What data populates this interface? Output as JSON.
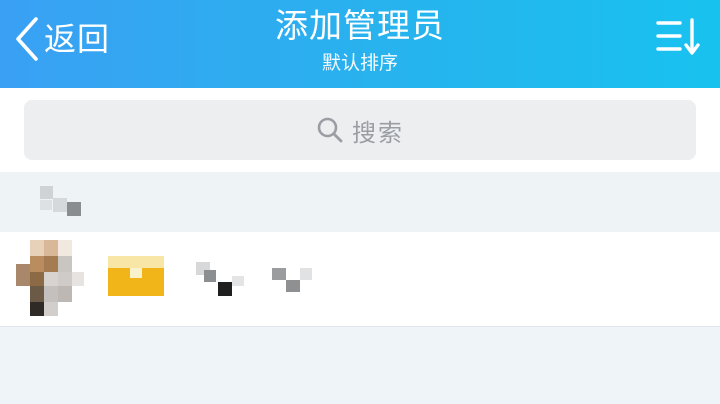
{
  "header": {
    "back_label": "返回",
    "title": "添加管理员",
    "subtitle": "默认排序",
    "back_icon": "chevron-left-icon",
    "sort_icon": "sort-icon"
  },
  "search": {
    "placeholder": "搜索",
    "icon": "search-icon"
  },
  "colors": {
    "header_gradient_start": "#3aa0f4",
    "header_gradient_end": "#18c2ef",
    "badge_yellow": "#f1b519"
  }
}
